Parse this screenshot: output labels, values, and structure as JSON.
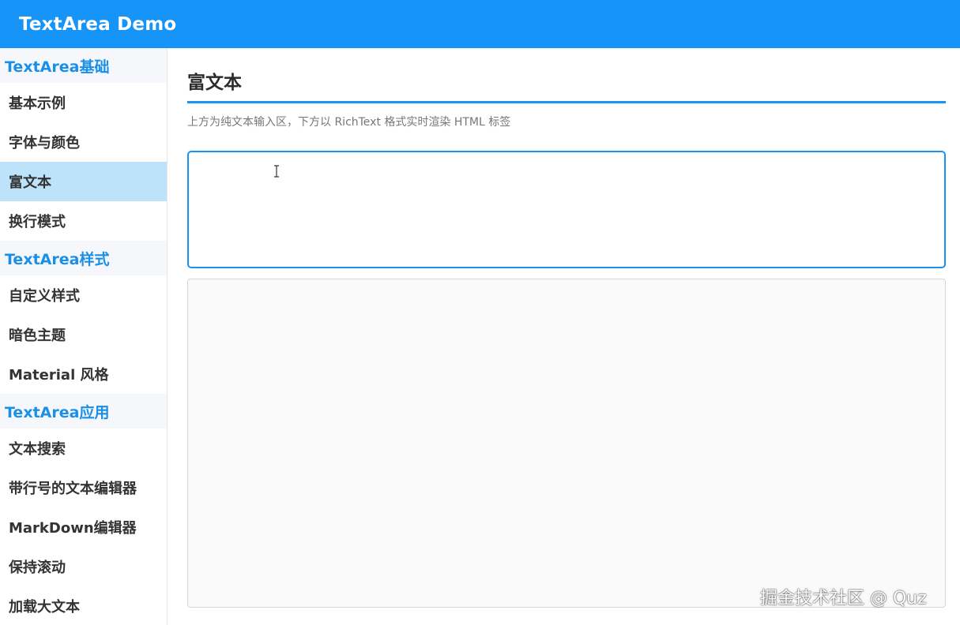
{
  "header": {
    "title": "TextArea Demo"
  },
  "sidebar": {
    "groups": [
      {
        "title": "TextArea基础",
        "items": [
          "基本示例",
          "字体与颜色",
          "富文本",
          "换行模式"
        ]
      },
      {
        "title": "TextArea样式",
        "items": [
          "自定义样式",
          "暗色主题",
          "Material 风格"
        ]
      },
      {
        "title": "TextArea应用",
        "items": [
          "文本搜索",
          "带行号的文本编辑器",
          "MarkDown编辑器",
          "保持滚动",
          "加载大文本"
        ]
      }
    ],
    "active_item": "富文本"
  },
  "main": {
    "title": "富文本",
    "subtitle": "上方为纯文本输入区，下方以 RichText 格式实时渲染 HTML 标签",
    "input_value": "",
    "output_html": ""
  },
  "watermark": "掘金技术社区 @ Quz",
  "colors": {
    "accent": "#1694f7",
    "active_bg": "#bde3fb",
    "group_text": "#1a8fe8"
  },
  "icons": {
    "cursor": "text-cursor-icon"
  }
}
